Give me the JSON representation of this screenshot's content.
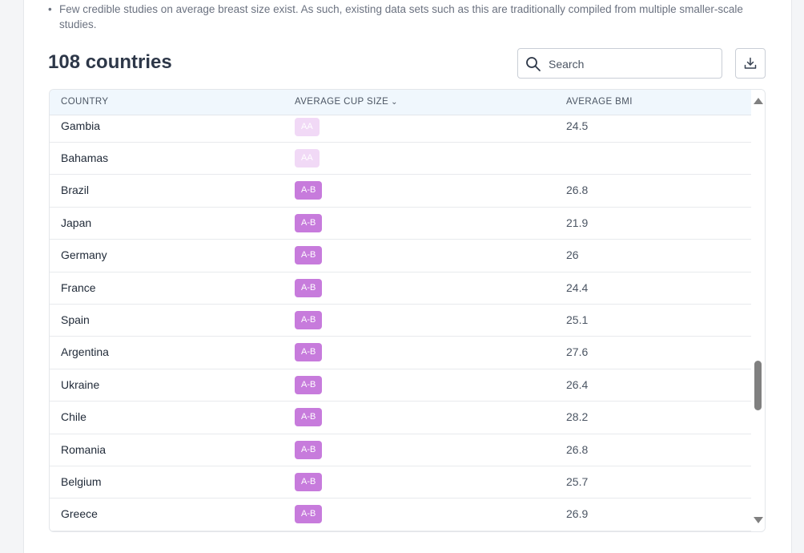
{
  "note": {
    "bullet": "•",
    "text": "Few credible studies on average breast size exist. As such, existing data sets such as this are traditionally compiled from multiple smaller-scale studies."
  },
  "title": "108 countries",
  "search": {
    "placeholder": "Search",
    "value": ""
  },
  "table": {
    "headers": {
      "country": "COUNTRY",
      "cup": "AVERAGE CUP SIZE",
      "bmi": "AVERAGE BMI"
    },
    "sort_indicator": "⌄",
    "rows": [
      {
        "country": "Gambia",
        "cup": "AA",
        "bmi": "24.5"
      },
      {
        "country": "Bahamas",
        "cup": "AA",
        "bmi": ""
      },
      {
        "country": "Brazil",
        "cup": "A-B",
        "bmi": "26.8"
      },
      {
        "country": "Japan",
        "cup": "A-B",
        "bmi": "21.9"
      },
      {
        "country": "Germany",
        "cup": "A-B",
        "bmi": "26"
      },
      {
        "country": "France",
        "cup": "A-B",
        "bmi": "24.4"
      },
      {
        "country": "Spain",
        "cup": "A-B",
        "bmi": "25.1"
      },
      {
        "country": "Argentina",
        "cup": "A-B",
        "bmi": "27.6"
      },
      {
        "country": "Ukraine",
        "cup": "A-B",
        "bmi": "26.4"
      },
      {
        "country": "Chile",
        "cup": "A-B",
        "bmi": "28.2"
      },
      {
        "country": "Romania",
        "cup": "A-B",
        "bmi": "26.8"
      },
      {
        "country": "Belgium",
        "cup": "A-B",
        "bmi": "25.7"
      },
      {
        "country": "Greece",
        "cup": "A-B",
        "bmi": "26.9"
      }
    ]
  },
  "colors": {
    "badge_aa": "#f1d9f6",
    "badge_ab": "#c77bdc",
    "header_bg": "#f0f7fd"
  },
  "icons": {
    "search": "search-icon",
    "download": "download-icon"
  }
}
